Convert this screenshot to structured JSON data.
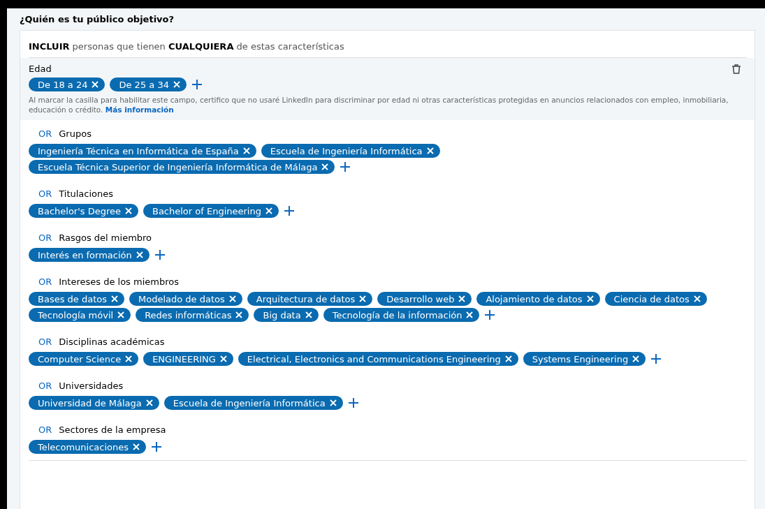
{
  "section": {
    "title": "¿Quién es tu público objetivo?"
  },
  "include": {
    "text": "**INCLUIR** personas que tienen **CUALQUIERA** de estas características"
  },
  "age": {
    "label": "Edad",
    "tags": [
      "De 18 a 24",
      "De 25 a 34"
    ],
    "disclaimer": "Al marcar la casilla para habilitar este campo, certifico que no usaré LinkedIn para discriminar por edad ni otras características protegidas en anuncios relacionados con empleo, inmobiliaria, educación o crédito.",
    "link": "Más información"
  },
  "groups": [
    {
      "connector": "OR",
      "label": "Grupos",
      "tags": [
        "Ingeniería Técnica en Informática de España",
        "Escuela de Ingeniería Informática",
        "Escuela Técnica Superior de Ingeniería Informática de Málaga"
      ]
    },
    {
      "connector": "OR",
      "label": "Titulaciones",
      "tags": [
        "Bachelor's Degree",
        "Bachelor of Engineering"
      ]
    },
    {
      "connector": "OR",
      "label": "Rasgos del miembro",
      "tags": [
        "Interés en formación"
      ]
    },
    {
      "connector": "OR",
      "label": "Intereses de los miembros",
      "tags": [
        "Bases de datos",
        "Modelado de datos",
        "Arquitectura de datos",
        "Desarrollo web",
        "Alojamiento de datos",
        "Ciencia de datos",
        "Tecnología móvil",
        "Redes informáticas",
        "Big data",
        "Tecnología de la información"
      ]
    },
    {
      "connector": "OR",
      "label": "Disciplinas académicas",
      "tags": [
        "Computer Science",
        "ENGINEERING",
        "Electrical, Electronics and Communications Engineering",
        "Systems Engineering"
      ]
    },
    {
      "connector": "OR",
      "label": "Universidades",
      "tags": [
        "Universidad de Málaga",
        "Escuela de Ingeniería Informática"
      ]
    },
    {
      "connector": "OR",
      "label": "Sectores de la empresa",
      "tags": [
        "Telecomunicaciones"
      ]
    }
  ]
}
